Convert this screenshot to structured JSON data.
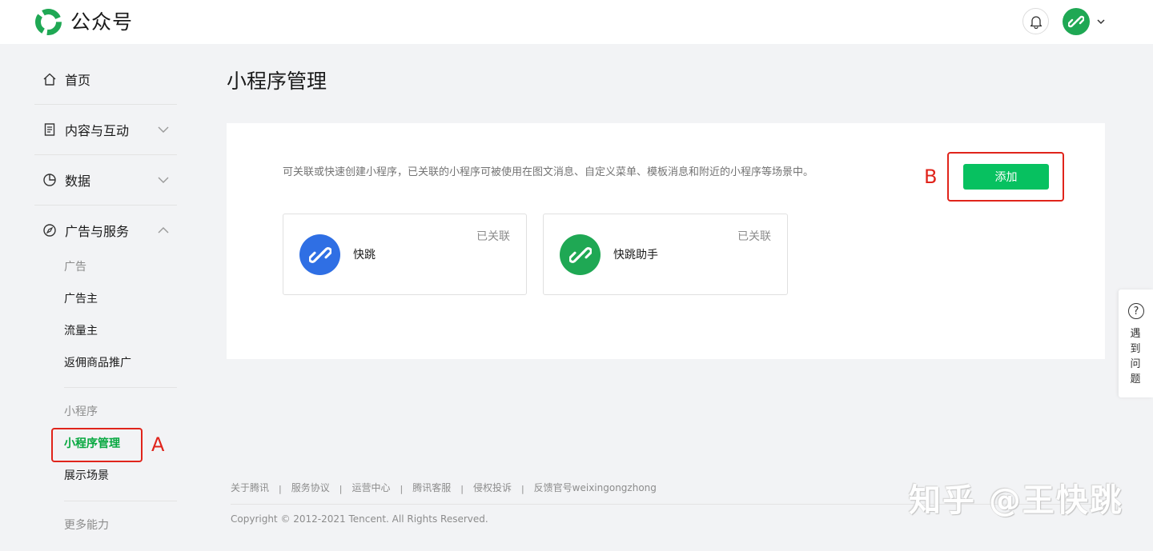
{
  "header": {
    "brand": "公众号",
    "logo_icon": "wechat-mp-logo-icon",
    "bell_icon": "bell-icon",
    "avatar_icon": "link-icon",
    "caret_icon": "chevron-down-icon"
  },
  "sidebar": {
    "home": "首页",
    "content": "内容与互动",
    "data": "数据",
    "ads": "广告与服务",
    "ads_caption": "广告",
    "advertiser": "广告主",
    "publisher": "流量主",
    "commission": "返佣商品推广",
    "mini_caption": "小程序",
    "mini_manage": "小程序管理",
    "showcase": "展示场景",
    "more_caption": "更多能力"
  },
  "annotations": {
    "a": "A",
    "b": "B"
  },
  "main": {
    "title": "小程序管理",
    "description": "可关联或快速创建小程序，已关联的小程序可被使用在图文消息、自定义菜单、模板消息和附近的小程序等场景中。",
    "add_button": "添加",
    "cards": [
      {
        "name": "快跳",
        "status": "已关联",
        "color": "#2f6fe4"
      },
      {
        "name": "快跳助手",
        "status": "已关联",
        "color": "#1fa854"
      }
    ]
  },
  "footer": {
    "links": [
      "关于腾讯",
      "服务协议",
      "运营中心",
      "腾讯客服",
      "侵权投诉",
      "反馈官号weixingongzhong"
    ],
    "separator": "|",
    "copyright": "Copyright © 2012-2021 Tencent. All Rights Reserved."
  },
  "watermark": "知乎 @王快跳",
  "help": {
    "text": "遇到问题",
    "icon": "?"
  },
  "colors": {
    "accent_green": "#07c160",
    "annotation_red": "#e0241b"
  }
}
